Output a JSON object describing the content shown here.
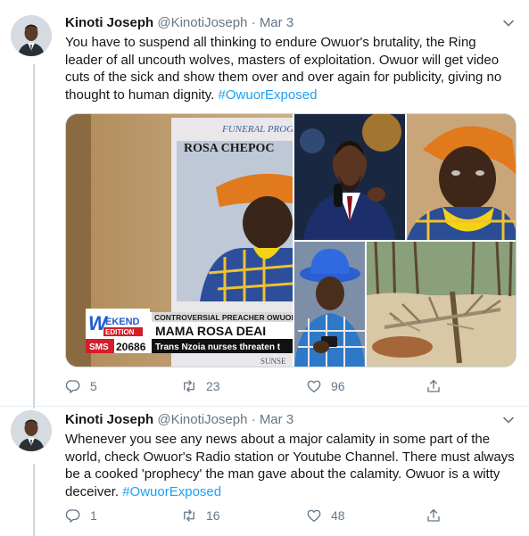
{
  "tweets": [
    {
      "name": "Kinoti Joseph",
      "handle": "@KinotiJoseph",
      "dot": "·",
      "date": "Mar 3",
      "text": "You have to suspend all thinking to endure Owuor's brutality, the Ring leader of all uncouth wolves, masters of exploitation. Owuor will get video cuts of the sick and show them over and over again for publicity, giving no thought to human dignity.",
      "hashtag": "#OwuorExposed",
      "replies": "5",
      "retweets": "23",
      "likes": "96",
      "media": {
        "poster_line1": "FUNERAL PROG",
        "poster_line2": "ROSA CHEPOC",
        "poster_sub": "SUNSE",
        "tv_logo_top": "EKEND",
        "tv_logo_w": "W",
        "tv_logo_bottom": "EDITION",
        "tv_headline_top": "CONTROVERSIAL PREACHER OWUOR ALLE",
        "tv_headline_main": "MAMA ROSA DEAI",
        "tv_sms": "SMS",
        "tv_sms_number": "20686",
        "tv_ticker": "Trans Nzoia nurses  threaten t"
      }
    },
    {
      "name": "Kinoti Joseph",
      "handle": "@KinotiJoseph",
      "dot": "·",
      "date": "Mar 3",
      "text": "Whenever you see any news about a major calamity in some part of the world, check Owuor's Radio station or Youtube Channel. There must always be a cooked 'prophecy' the man gave about the calamity. Owuor is a witty deceiver.",
      "hashtag": "#OwuorExposed",
      "replies": "1",
      "retweets": "16",
      "likes": "48"
    }
  ],
  "colors": {
    "link": "#1da1f2",
    "secondary_text": "#657786",
    "primary_text": "#14171a",
    "border": "#e6ecf0"
  },
  "icons": [
    "caret-down-icon",
    "reply-icon",
    "retweet-icon",
    "like-icon",
    "share-icon"
  ]
}
